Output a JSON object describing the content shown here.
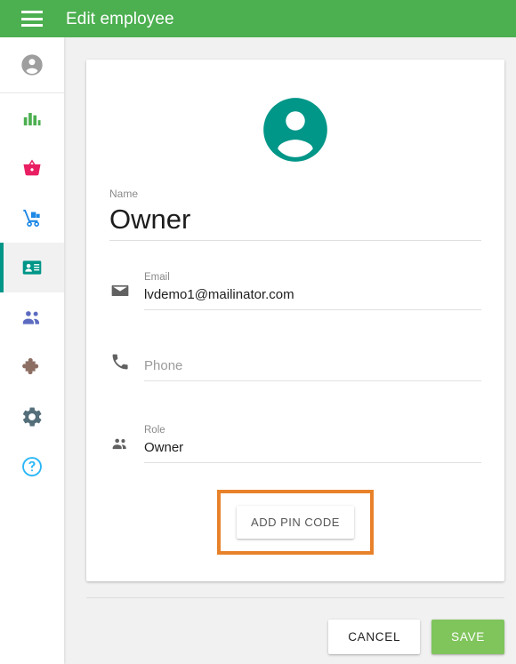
{
  "header": {
    "menu_icon": "hamburger-menu-icon",
    "title": "Edit employee",
    "bg_color": "#4caf50"
  },
  "sidebar": {
    "account_avatar_icon": "account-circle-icon",
    "items": [
      {
        "icon": "bar-chart-icon",
        "name": "reports",
        "color": "#4caf50",
        "active": false
      },
      {
        "icon": "shopping-basket-icon",
        "name": "sales",
        "color": "#e91e63",
        "active": false
      },
      {
        "icon": "delivery-cart-icon",
        "name": "inventory",
        "color": "#1e88e5",
        "active": false
      },
      {
        "icon": "id-badge-icon",
        "name": "employees",
        "color": "#009688",
        "active": true
      },
      {
        "icon": "people-group-icon",
        "name": "customers",
        "color": "#5c6bc0",
        "active": false
      },
      {
        "icon": "puzzle-piece-icon",
        "name": "integrations",
        "color": "#8d6e63",
        "active": false
      },
      {
        "icon": "gear-icon",
        "name": "settings",
        "color": "#546e7a",
        "active": false
      },
      {
        "icon": "help-circle-icon",
        "name": "help",
        "color": "#29b6f6",
        "active": false
      }
    ],
    "active_indicator_color": "#009688"
  },
  "card": {
    "avatar_icon": "account-circle-icon",
    "avatar_color": "#009688",
    "fields": {
      "name": {
        "label": "Name",
        "value": "Owner",
        "placeholder": "Name",
        "icon": ""
      },
      "email": {
        "label": "Email",
        "value": "lvdemo1@mailinator.com",
        "placeholder": "Email",
        "icon": "email-icon"
      },
      "phone": {
        "label": "",
        "value": "",
        "placeholder": "Phone",
        "icon": "phone-icon"
      },
      "role": {
        "label": "Role",
        "value": "Owner",
        "placeholder": "Role",
        "icon": "people-icon"
      }
    },
    "pin_button": {
      "label": "ADD PIN CODE",
      "highlight_color": "#e8822a"
    }
  },
  "footer": {
    "cancel_label": "CANCEL",
    "save_label": "SAVE",
    "save_color": "#80c45c"
  }
}
